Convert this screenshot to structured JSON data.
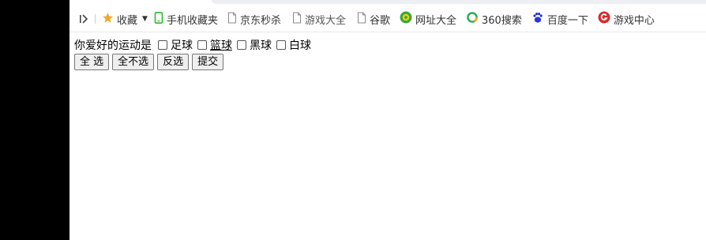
{
  "bookmarks": {
    "toggle_icon": "sidebar-toggle-icon",
    "favorites": {
      "label": "收藏",
      "icon": "star-icon",
      "color": "#f5a623"
    },
    "items": [
      {
        "label": "手机收藏夹",
        "icon": "phone-icon",
        "color": "#2eb82e"
      },
      {
        "label": "京东秒杀",
        "icon": "page-icon"
      },
      {
        "label": "游戏大全",
        "icon": "page-icon"
      },
      {
        "label": "谷歌",
        "icon": "page-icon"
      },
      {
        "label": "网址大全",
        "icon": "navigation-icon",
        "color": "#3aa83a"
      },
      {
        "label": "360搜索",
        "icon": "search-360-icon",
        "color": "#1fae4f"
      },
      {
        "label": "百度一下",
        "icon": "baidu-paw-icon",
        "color": "#2932e1"
      },
      {
        "label": "游戏中心",
        "icon": "game-center-icon",
        "color": "#d92b2b"
      }
    ]
  },
  "form": {
    "question": "你爱好的运动是",
    "options": [
      "足球",
      "篮球",
      "黑球",
      "白球"
    ],
    "buttons": [
      "全 选",
      "全不选",
      "反选",
      "提交"
    ]
  }
}
